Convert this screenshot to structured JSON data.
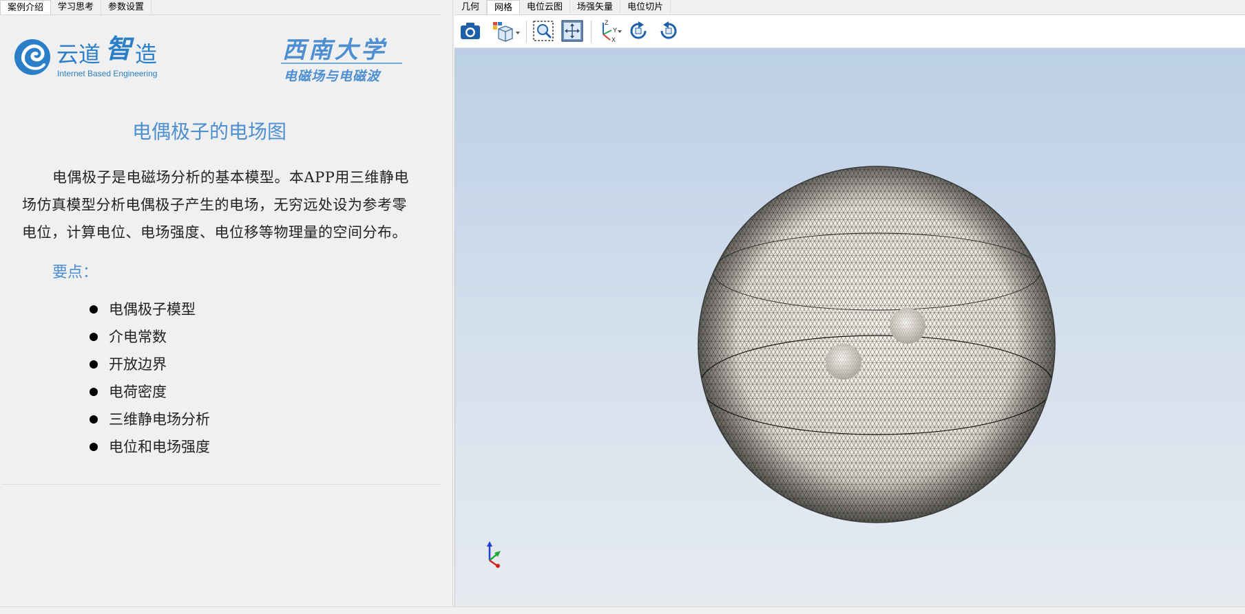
{
  "left_tabs": [
    {
      "label": "案例介绍",
      "active": true
    },
    {
      "label": "学习思考",
      "active": false
    },
    {
      "label": "参数设置",
      "active": false
    }
  ],
  "logos": {
    "brand_chinese_parts": [
      "云道",
      "智",
      "造"
    ],
    "brand_english": "Internet Based Engineering",
    "university_name": "西南大学",
    "university_course": "电磁场与电磁波"
  },
  "content": {
    "title": "电偶极子的电场图",
    "intro": "电偶极子是电磁场分析的基本模型。本APP用三维静电场仿真模型分析电偶极子产生的电场，无穷远处设为参考零电位，计算电位、电场强度、电位移等物理量的空间分布。",
    "points_heading": "要点：",
    "points": [
      "电偶极子模型",
      "介电常数",
      "开放边界",
      "电荷密度",
      "三维静电场分析",
      "电位和电场强度"
    ]
  },
  "right_tabs": [
    {
      "label": "几何",
      "active": false
    },
    {
      "label": "网格",
      "active": true
    },
    {
      "label": "电位云图",
      "active": false
    },
    {
      "label": "场强矢量",
      "active": false
    },
    {
      "label": "电位切片",
      "active": false
    }
  ],
  "toolbar": {
    "axis_labels": {
      "z": "Z",
      "y": "Y",
      "x": "X"
    }
  },
  "colors": {
    "accent": "#4d8fd1",
    "brand_blue": "#2a7fc8",
    "viewport_top": "#bbcfe6",
    "viewport_bottom": "#e7ebf0"
  }
}
